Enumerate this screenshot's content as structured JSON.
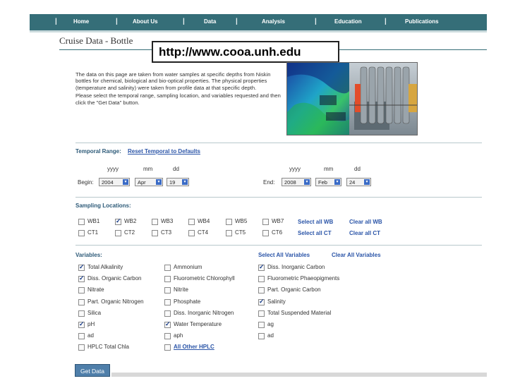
{
  "nav": {
    "items": [
      "Home",
      "About Us",
      "Data",
      "Analysis",
      "Education",
      "Publications"
    ],
    "separator": "|"
  },
  "page_title": "Cruise Data - Bottle",
  "url_overlay": "http://www.cooa.unh.edu",
  "intro": {
    "p1": "The data on this page are taken from water samples at specific depths from Niskin bottles for chemical, biological and bio-optical properties. The physical properties (temperature and salinity) were taken from profile data at that specific depth.",
    "p2": "Please select the temporal range, sampling location, and variables requested and then click the \"Get Data\" button."
  },
  "temporal": {
    "label": "Temporal Range:",
    "reset_link": "Reset Temporal to Defaults",
    "col_yyyy": "yyyy",
    "col_mm": "mm",
    "col_dd": "dd",
    "begin_label": "Begin:",
    "begin_year": "2004",
    "begin_month": "Apr",
    "begin_day": "19",
    "end_label": "End:",
    "end_year": "2008",
    "end_month": "Feb",
    "end_day": "24"
  },
  "sampling": {
    "label": "Sampling Locations:",
    "wb": [
      {
        "label": "WB1",
        "checked": false
      },
      {
        "label": "WB2",
        "checked": true
      },
      {
        "label": "WB3",
        "checked": false
      },
      {
        "label": "WB4",
        "checked": false
      },
      {
        "label": "WB5",
        "checked": false
      },
      {
        "label": "WB7",
        "checked": false
      }
    ],
    "ct": [
      {
        "label": "CT1",
        "checked": false
      },
      {
        "label": "CT2",
        "checked": false
      },
      {
        "label": "CT3",
        "checked": false
      },
      {
        "label": "CT4",
        "checked": false
      },
      {
        "label": "CT5",
        "checked": false
      },
      {
        "label": "CT6",
        "checked": false
      }
    ],
    "select_all_wb": "Select all WB",
    "clear_all_wb": "Clear all WB",
    "select_all_ct": "Select all CT",
    "clear_all_ct": "Clear all CT"
  },
  "variables": {
    "label": "Variables:",
    "select_all": "Select All Variables",
    "clear_all": "Clear All Variables",
    "col1": [
      {
        "label": "Total Alkalinity",
        "checked": true
      },
      {
        "label": "Diss. Organic Carbon",
        "checked": true
      },
      {
        "label": "Nitrate",
        "checked": false
      },
      {
        "label": "Part. Organic Nitrogen",
        "checked": false
      },
      {
        "label": "Silica",
        "checked": false
      },
      {
        "label": "pH",
        "checked": true
      },
      {
        "label": "ad",
        "checked": false
      },
      {
        "label": "HPLC Total Chla",
        "checked": false
      }
    ],
    "col2": [
      {
        "label": "Ammonium",
        "checked": false
      },
      {
        "label": "Fluorometric Chlorophyll",
        "checked": false
      },
      {
        "label": "Nitrite",
        "checked": false
      },
      {
        "label": "Phosphate",
        "checked": false
      },
      {
        "label": "Diss. Inorganic Nitrogen",
        "checked": false
      },
      {
        "label": "Water Temperature",
        "checked": true
      },
      {
        "label": "aph",
        "checked": false
      },
      {
        "label": "All Other HPLC",
        "checked": false,
        "link": true
      }
    ],
    "col3": [
      {
        "label": "Diss. Inorganic Carbon",
        "checked": true
      },
      {
        "label": "Fluorometric Phaeopigments",
        "checked": false
      },
      {
        "label": "Part. Organic Carbon",
        "checked": false
      },
      {
        "label": "Salinity",
        "checked": true
      },
      {
        "label": "Total Suspended Material",
        "checked": false
      },
      {
        "label": "ag",
        "checked": false
      },
      {
        "label": "ad",
        "checked": false
      }
    ]
  },
  "get_data_button": "Get Data",
  "colors": {
    "nav_bg": "#356e78",
    "link": "#2b55a8",
    "section_label": "#2d5a78",
    "button": "#4f7faa"
  }
}
